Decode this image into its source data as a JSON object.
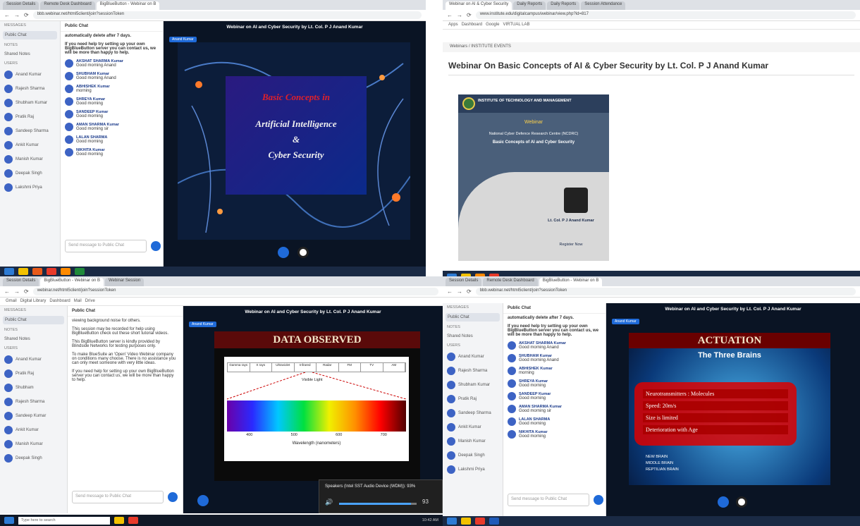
{
  "q1": {
    "tabs": [
      "Session Details",
      "Remote Desk Dashboard",
      "BigBlueButton - Webinar on B"
    ],
    "url": "bbb.webinar.net/html5client/join?sessionToken",
    "side_label": "MESSAGES",
    "public_chat": "Public Chat",
    "notes_hd": "NOTES",
    "notes": "Shared Notes",
    "users_hd": "USERS",
    "users": [
      "Anand Kumar",
      "Rajesh Sharma",
      "Shubham Kumar",
      "Pratik Raj",
      "Sandeep Sharma",
      "Ankit Kumar",
      "Manish Kumar",
      "Deepak Singh",
      "Lakshmi Priya"
    ],
    "chat_hd": "Public Chat",
    "chat_intro": "automatically delete after 7 days.",
    "chat_help": "If you need help try setting up your own BigBlueButton server you can contact us, we will be more than happy to help.",
    "messages": [
      {
        "name": "AKSHAT SHARMA Kumar",
        "text": "Good morning Anand"
      },
      {
        "name": "SHUBHAM Kumar",
        "text": "Good morning Anand"
      },
      {
        "name": "ABHISHEK Kumar",
        "text": "morning"
      },
      {
        "name": "SHREYA Kumar",
        "text": "Good morning"
      },
      {
        "name": "SANDEEP Kumar",
        "text": "Good morning"
      },
      {
        "name": "AMAN SHARMA Kumar",
        "text": "Good morning sir"
      },
      {
        "name": "LALAN SHARMA",
        "text": "Good morning"
      },
      {
        "name": "NIKHITA Kumar",
        "text": "Good morning"
      }
    ],
    "chat_placeholder": "Send message to Public Chat",
    "stage_title": "Webinar on AI and Cyber Security by Lt. Col. P J Anand Kumar",
    "badge": "Anand Kumar",
    "slide": {
      "l1": "Basic Concepts in",
      "l2": "Artificial Intelligence",
      "l3": "&",
      "l4": "Cyber Security"
    }
  },
  "q2": {
    "tabs": [
      "Webinar on AI & Cyber Security",
      "Daily Reports",
      "Daily Reports",
      "Session Attendance"
    ],
    "url": "www.institute.edu/digitalcampus/webinar/view.php?id=817",
    "bookmarks": [
      "Apps",
      "Dashboard",
      "Google",
      "VIRTUAL LAB"
    ],
    "breadcrumb": "Webinars / INSTITUTE EVENTS",
    "title": "Webinar On Basic Concepts of AI & Cyber Security by Lt. Col. P J Anand Kumar",
    "poster": {
      "inst": "INSTITUTE OF TECHNOLOGY AND MANAGEMENT",
      "event": "Webinar",
      "org": "National Cyber Defence Research Centre (NCDRC)",
      "topic": "Basic Concepts of AI and Cyber Security",
      "speaker": "Lt. Col. P J Anand Kumar",
      "footer": "Register Now"
    }
  },
  "q3": {
    "tabs": [
      "Session Details",
      "BigBlueButton - Webinar on B",
      "Webinar Session"
    ],
    "url": "webinar.net/html5client/join?sessionToken",
    "bookmarks": [
      "Gmail",
      "Digital Library",
      "Dashboard",
      "Mail",
      "Drive"
    ],
    "side_label": "MESSAGES",
    "public_chat": "Public Chat",
    "notes_hd": "NOTES",
    "notes": "Shared Notes",
    "users_hd": "USERS",
    "users": [
      "Anand Kumar",
      "Pratik Raj",
      "Shubham",
      "Rajesh Sharma",
      "Sandeep Kumar",
      "Ankit Kumar",
      "Manish Kumar",
      "Deepak Singh"
    ],
    "chat_hd": "Public Chat",
    "chat_lines": [
      "viewing background noise for others.",
      "This session may be recorded for help using BigBlueButton check out these short tutorial videos.",
      "This BigBlueButton server is kindly provided by Blindside Networks for testing purposes only.",
      "To make BlueSuite an 'Open' Video Webinar company on conditions many choose. There is no assistance you can only meet someone with very little ideas.",
      "If you need help for setting up your own BigBlueButton server you can contact us, we will be more than happy to help."
    ],
    "chat_placeholder": "Send message to Public Chat",
    "stage_title": "Webinar on AI and Cyber Security by Lt. Col. P J Anand Kumar",
    "badge": "Anand Kumar",
    "slide_title": "DATA OBSERVED",
    "spectrum_labels": [
      "Gamma rays",
      "X rays",
      "Ultraviolet",
      "Infrared",
      "Radar",
      "FM",
      "TV",
      "AM"
    ],
    "visible_light": "Visible Light",
    "wl_axis": "Wavelength (nanometers)",
    "wl_ticks": [
      "400",
      "500",
      "600",
      "700"
    ],
    "popup": "Speakers (Intel SST Audio Device (WDM)): 93%",
    "volume_pct": 93,
    "search": "Type here to search",
    "tray_time": "10:42 AM"
  },
  "q4": {
    "tabs": [
      "Session Details",
      "Remote Desk Dashboard",
      "BigBlueButton - Webinar on B"
    ],
    "url": "bbb.webinar.net/html5client/join?sessionToken",
    "side_label": "MESSAGES",
    "public_chat": "Public Chat",
    "notes_hd": "NOTES",
    "notes": "Shared Notes",
    "users_hd": "USERS",
    "users": [
      "Anand Kumar",
      "Rajesh Sharma",
      "Shubham Kumar",
      "Pratik Raj",
      "Sandeep Sharma",
      "Ankit Kumar",
      "Manish Kumar",
      "Deepak Singh",
      "Lakshmi Priya"
    ],
    "chat_hd": "Public Chat",
    "chat_intro": "automatically delete after 7 days.",
    "chat_help": "If you need help try setting up your own BigBlueButton server you can contact us, we will be more than happy to help.",
    "messages": [
      {
        "name": "AKSHAT SHARMA Kumar",
        "text": "Good morning Anand"
      },
      {
        "name": "SHUBHAM Kumar",
        "text": "Good morning Anand"
      },
      {
        "name": "ABHISHEK Kumar",
        "text": "morning"
      },
      {
        "name": "SHREYA Kumar",
        "text": "Good morning"
      },
      {
        "name": "SANDEEP Kumar",
        "text": "Good morning"
      },
      {
        "name": "AMAN SHARMA Kumar",
        "text": "Good morning sir"
      },
      {
        "name": "LALAN SHARMA",
        "text": "Good morning"
      },
      {
        "name": "NIKHITA Kumar",
        "text": "Good morning"
      }
    ],
    "chat_placeholder": "Send message to Public Chat",
    "stage_title": "Webinar on AI and Cyber Security by Lt. Col. P J Anand Kumar",
    "badge": "Anand Kumar",
    "slide": {
      "title": "ACTUATION",
      "sub": "The Three Brains",
      "items": [
        "Neurotransmitters : Molecules",
        "Speed: 20m/s",
        "Size is limited",
        "Deterioration with Age"
      ],
      "brain_labels": [
        "NEW BRAIN",
        "MIDDLE BRAIN",
        "REPTILIAN BRAIN"
      ]
    }
  }
}
